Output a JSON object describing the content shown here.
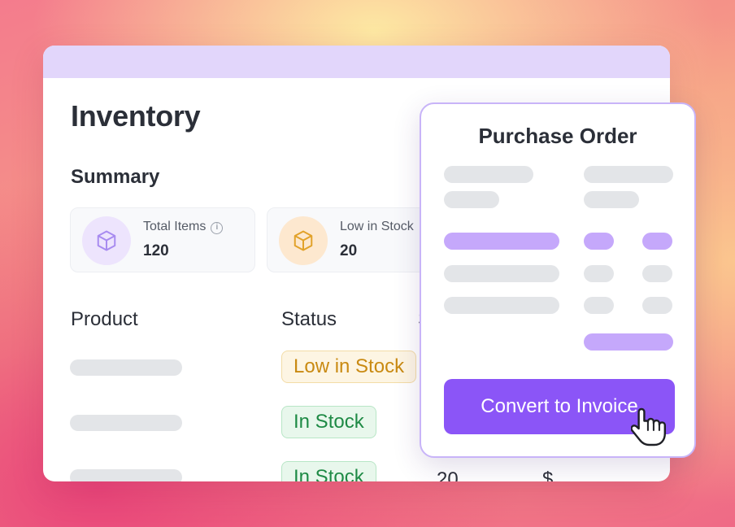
{
  "inventory": {
    "title": "Inventory",
    "summary_title": "Summary",
    "cards": [
      {
        "label": "Total Items",
        "value": "120",
        "icon": "cube-icon",
        "has_info_icon": true
      },
      {
        "label": "Low in Stock",
        "value": "20",
        "icon": "cube-icon"
      }
    ],
    "table": {
      "headers": [
        "Product",
        "Status",
        "S"
      ],
      "rows": [
        {
          "status": "Low in Stock",
          "status_kind": "warning"
        },
        {
          "status": "In Stock",
          "status_kind": "success"
        },
        {
          "status": "In Stock",
          "status_kind": "success",
          "quantity": "20",
          "price": "$"
        }
      ]
    }
  },
  "purchase_order": {
    "title": "Purchase Order",
    "button_label": "Convert to Invoice"
  },
  "colors": {
    "accent": "#8b55f7",
    "accent_light": "#c5a8fb",
    "window_bar": "#e2d6fb",
    "warning_text": "#c98a12",
    "success_text": "#1e8a45"
  }
}
